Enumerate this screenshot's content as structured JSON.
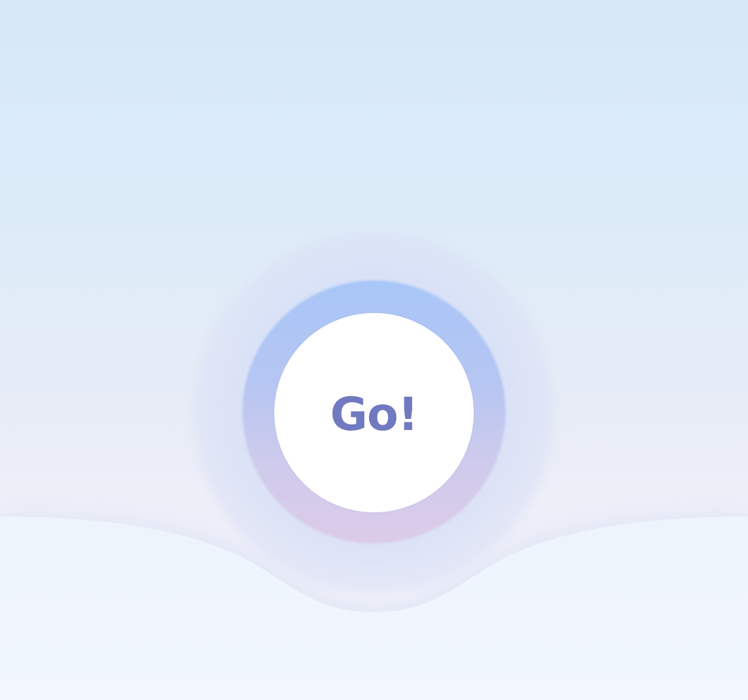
{
  "go_button": {
    "label": "Go!"
  },
  "colors": {
    "background_top": "#d6e8f7",
    "background_bottom": "#f0f6fd",
    "ring_top": "#a8c6f8",
    "ring_bottom": "#dccbe8",
    "button_fill": "#ffffff",
    "label_color": "#7179c0"
  }
}
